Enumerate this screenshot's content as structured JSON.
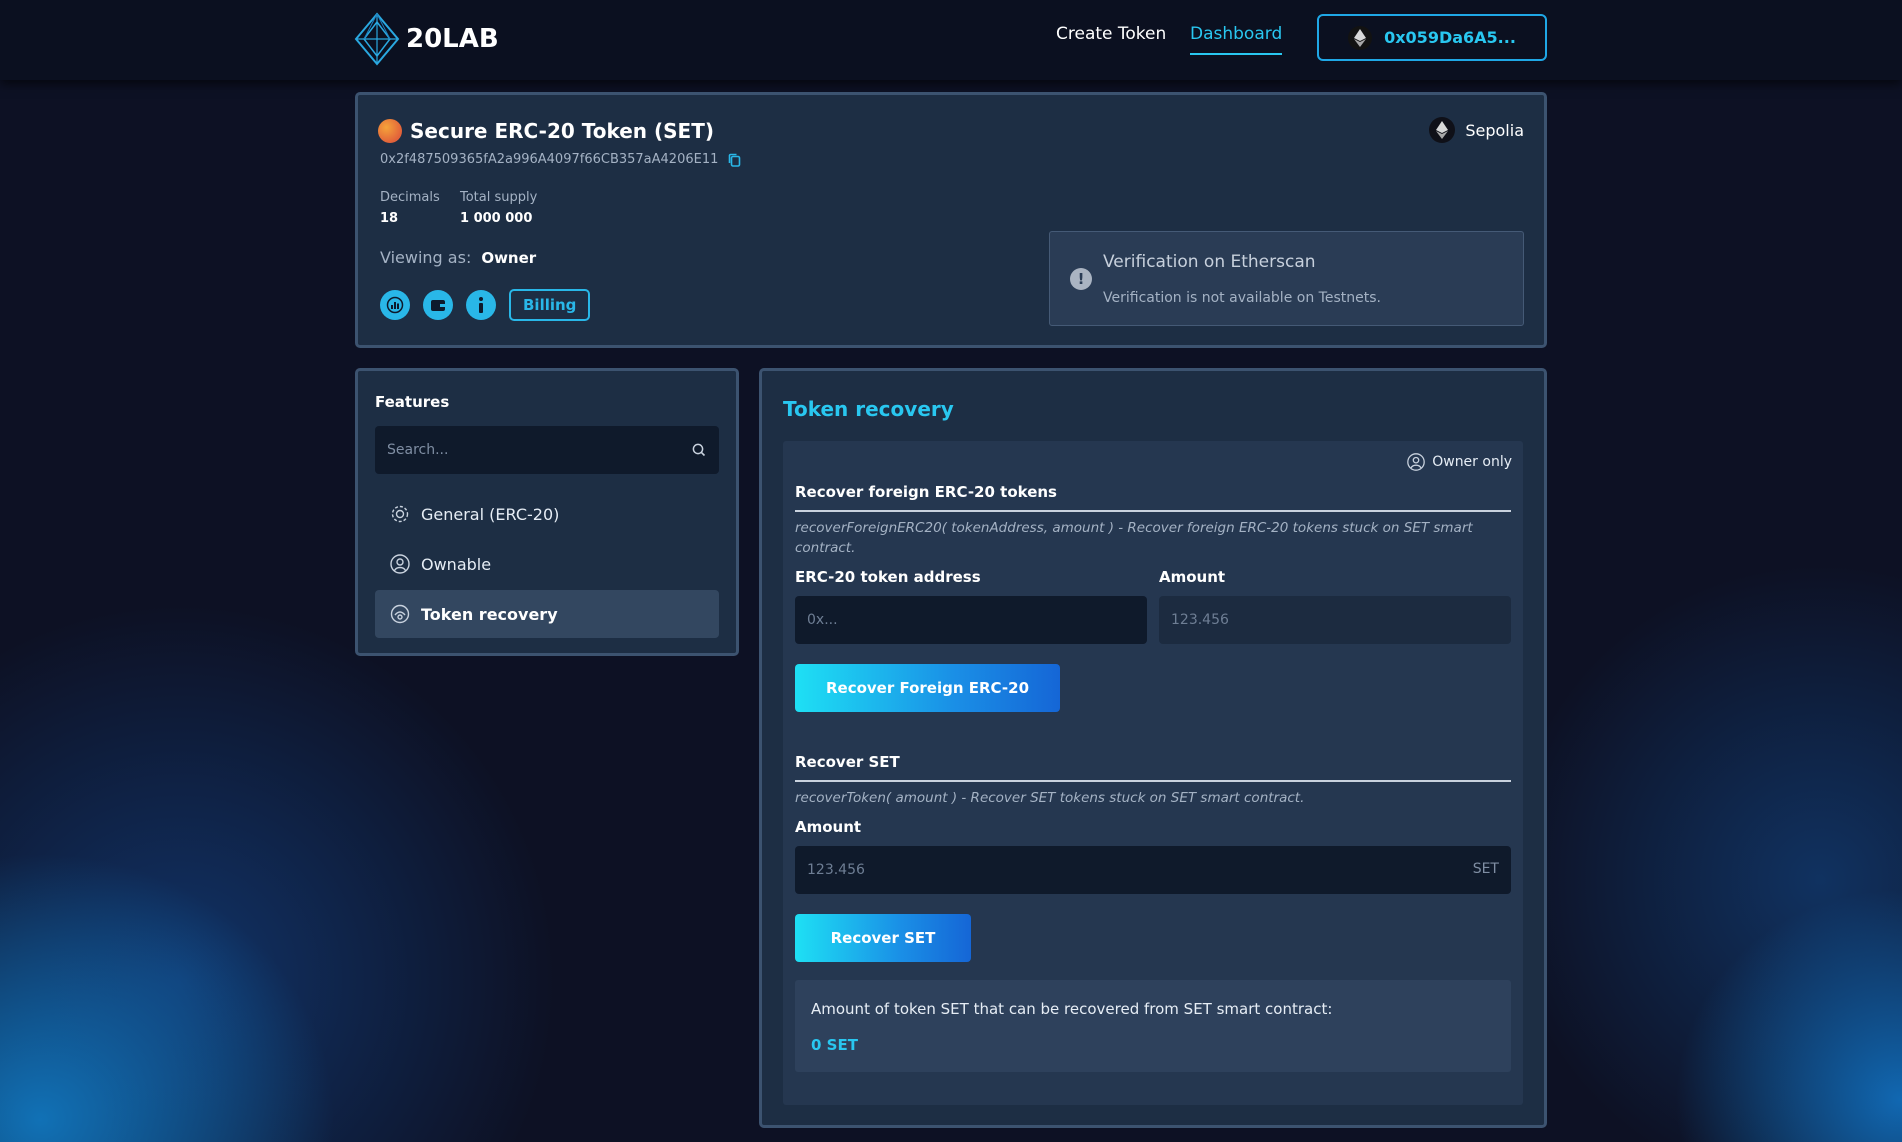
{
  "header": {
    "logo_text": "20LAB",
    "nav": {
      "create": "Create Token",
      "dashboard": "Dashboard"
    },
    "wallet": "0x059Da6A5..."
  },
  "token": {
    "title": "Secure ERC-20 Token (SET)",
    "address": "0x2f487509365fA2a996A4097f66CB357aA4206E11",
    "network": "Sepolia",
    "decimals_label": "Decimals",
    "decimals": "18",
    "supply_label": "Total supply",
    "supply": "1 000 000",
    "viewing_label": "Viewing as:",
    "viewing_role": "Owner",
    "billing": "Billing",
    "verification": {
      "title": "Verification on Etherscan",
      "text": "Verification is not available on Testnets.",
      "icon": "!"
    }
  },
  "features": {
    "title": "Features",
    "search_placeholder": "Search...",
    "items": [
      {
        "label": "General (ERC-20)",
        "icon": "gear-icon"
      },
      {
        "label": "Ownable",
        "icon": "user-icon"
      },
      {
        "label": "Token recovery",
        "icon": "recovery-icon"
      }
    ]
  },
  "recovery": {
    "title": "Token recovery",
    "owner_only": "Owner only",
    "foreign": {
      "title": "Recover foreign ERC-20 tokens",
      "desc": "recoverForeignERC20( tokenAddress, amount ) - Recover foreign ERC-20 tokens stuck on SET smart contract.",
      "address_label": "ERC-20 token address",
      "address_placeholder": "0x...",
      "amount_label": "Amount",
      "amount_placeholder": "123.456",
      "button": "Recover Foreign ERC-20"
    },
    "own": {
      "title": "Recover SET",
      "desc": "recoverToken( amount ) - Recover SET tokens stuck on SET smart contract.",
      "amount_label": "Amount",
      "amount_placeholder": "123.456",
      "suffix": "SET",
      "button": "Recover SET"
    },
    "info": {
      "text": "Amount of token SET that can be recovered from SET smart contract:",
      "value": "0 SET"
    }
  }
}
